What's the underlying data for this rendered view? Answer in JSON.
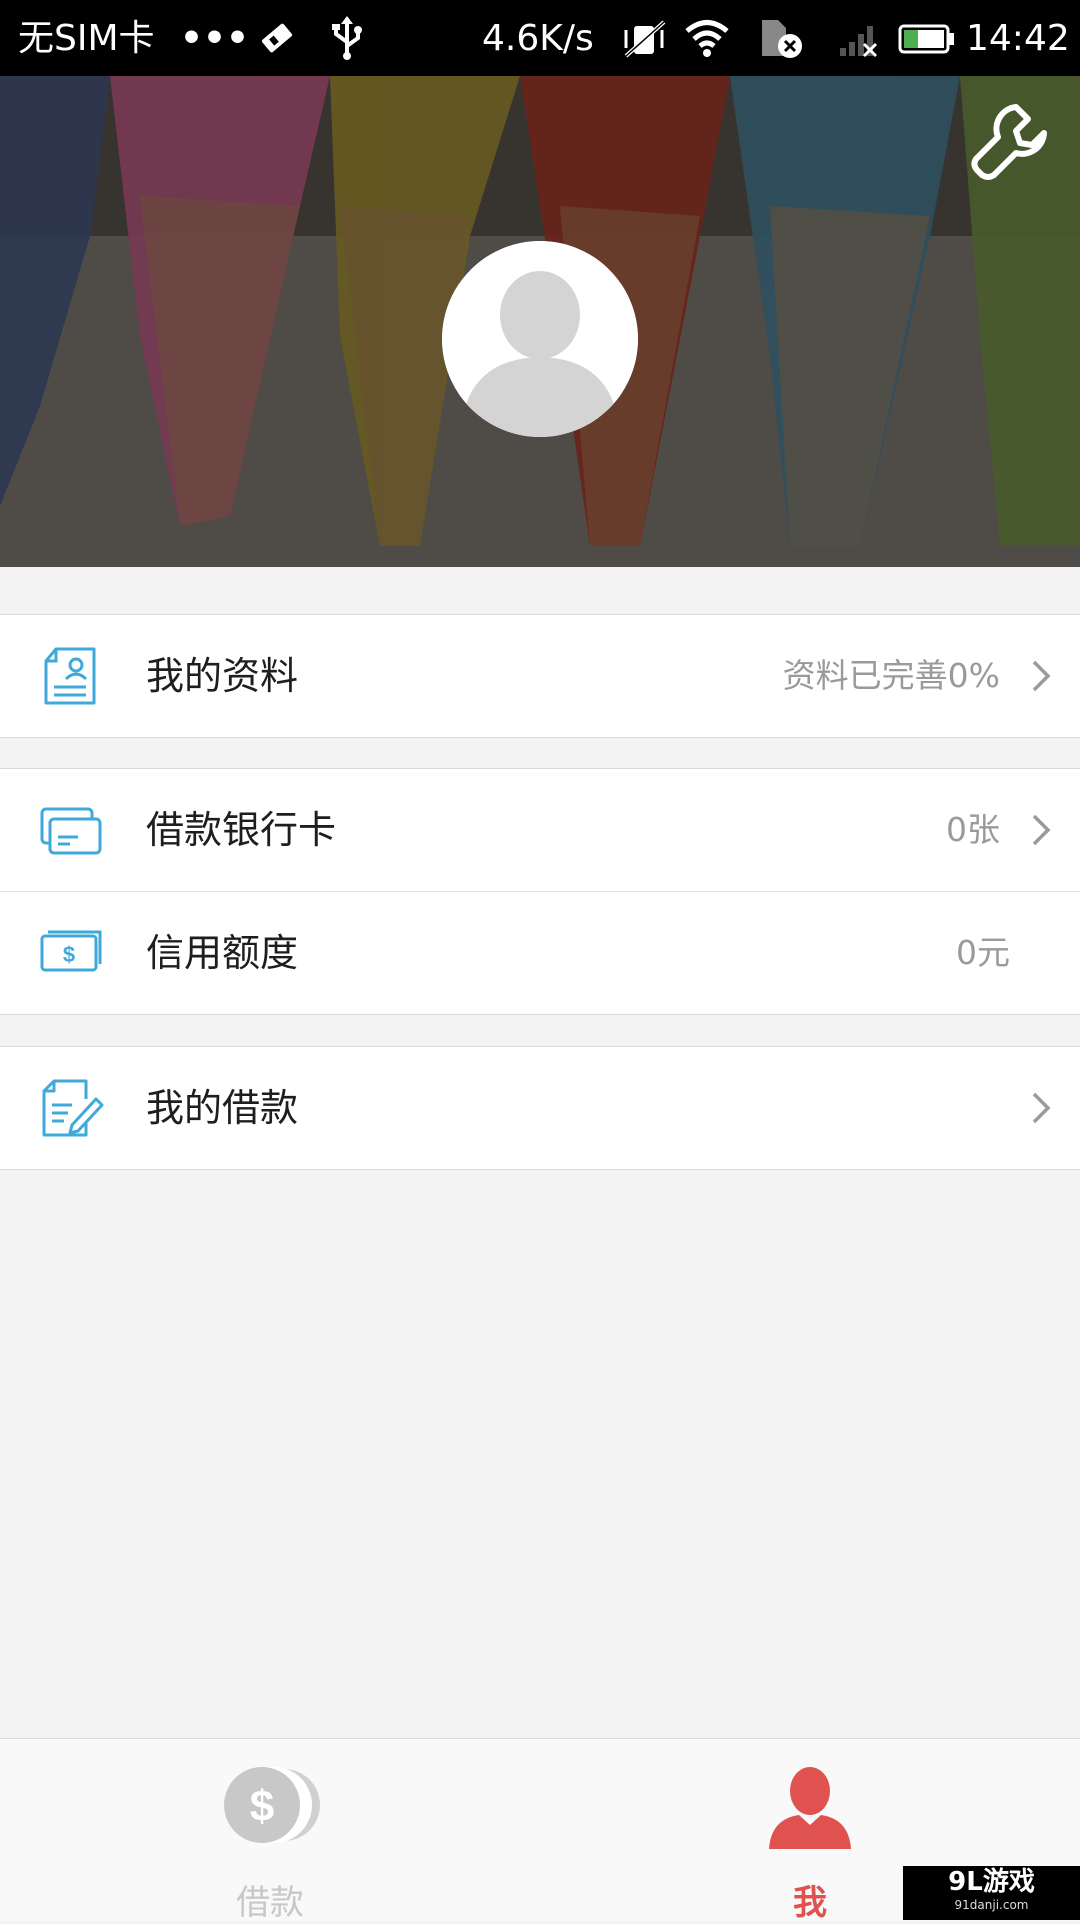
{
  "status_bar": {
    "carrier": "无SIM卡",
    "dots": "•••",
    "speed": "4.6K/s",
    "time": "14:42",
    "battery_level": 0.35
  },
  "header": {
    "avatar_icon": "user-avatar-icon",
    "settings_icon": "wrench-icon"
  },
  "menu": {
    "profile": {
      "label": "我的资料",
      "value": "资料已完善0%",
      "icon": "profile-doc-icon"
    },
    "bank_card": {
      "label": "借款银行卡",
      "value": "0张",
      "icon": "bank-card-icon"
    },
    "credit_limit": {
      "label": "信用额度",
      "value": "0元",
      "icon": "money-bill-icon"
    },
    "my_loans": {
      "label": "我的借款",
      "icon": "edit-doc-icon"
    }
  },
  "tabbar": {
    "loan_label": "借款",
    "me_label": "我",
    "active": "me",
    "colors": {
      "active": "#e0524f",
      "inactive": "#c8c8c8"
    }
  },
  "watermark": {
    "logo": "9L游戏",
    "site": "91danji.com"
  },
  "colors": {
    "accent_icon": "#3fa9d9",
    "background": "#f3f3f3"
  }
}
